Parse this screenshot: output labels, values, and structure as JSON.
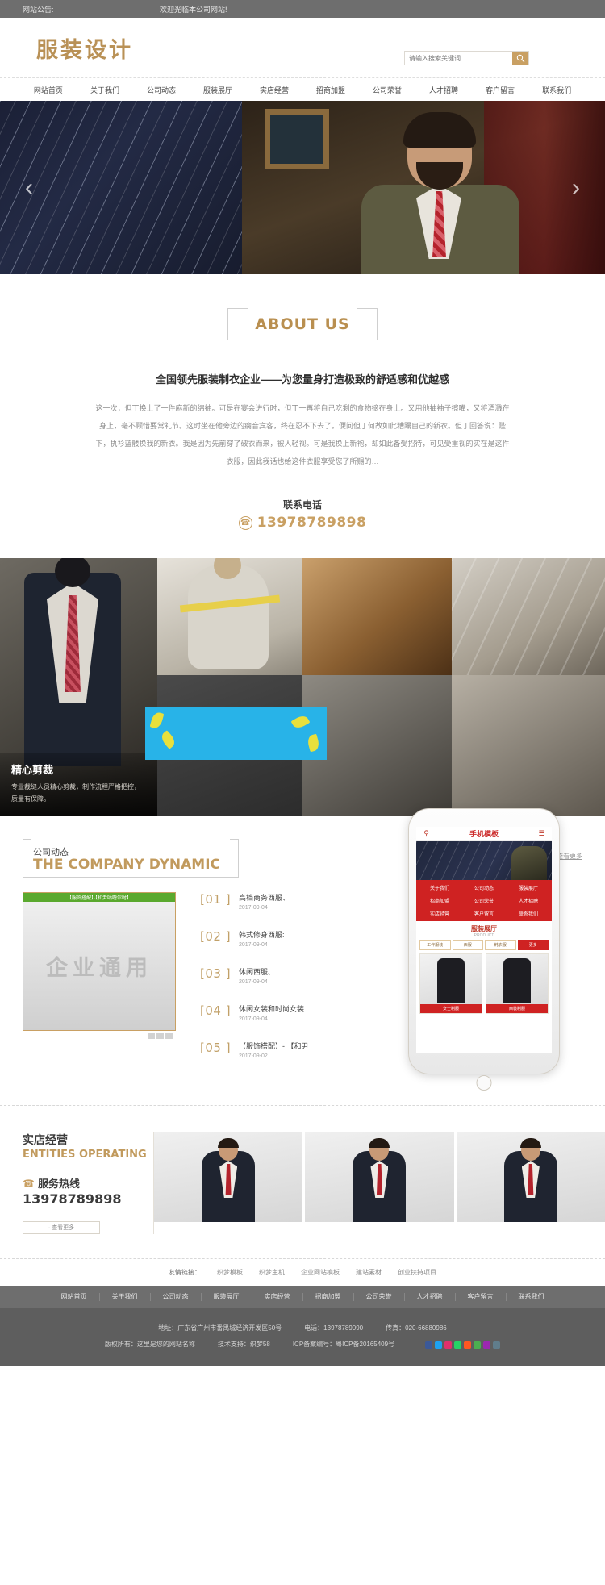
{
  "topbar": {
    "label": "网站公告:",
    "message": "欢迎光临本公司网站!"
  },
  "header": {
    "logo": "服装设计",
    "search": {
      "placeholder": "请输入搜索关键词",
      "value": "",
      "icon": "search-icon"
    }
  },
  "nav": [
    {
      "label": "网站首页"
    },
    {
      "label": "关于我们"
    },
    {
      "label": "公司动态"
    },
    {
      "label": "服装展厅"
    },
    {
      "label": "实店经营"
    },
    {
      "label": "招商加盟"
    },
    {
      "label": "公司荣誉"
    },
    {
      "label": "人才招聘"
    },
    {
      "label": "客户留言"
    },
    {
      "label": "联系我们"
    }
  ],
  "banner": {
    "prev_icon": "chevron-left-icon",
    "next_icon": "chevron-right-icon"
  },
  "about": {
    "badge": "ABOUT US",
    "headline": "全国领先服装制衣企业——为您量身打造极致的舒适感和优越感",
    "body": "这一次，但丁换上了一件麻新的绵袖。可是在宴会进行时，但丁一再将自己吃剩的食物摘在身上。又用他抽袖子擦嘴，又将酒溅在身上，毫不顾惜要常礼节。这时坐在他旁边的瘸音宾客，终在忍不下去了。便问但丁何故如此糟蹋自己的新衣。但丁回答说：陛下，执衫蓝髅换我的新衣。我是因为先前穿了破衣而来，被人轻视。可是我换上新袍，却如此备受招待，可见受重视的实在是这件衣服，因此我话也给这件衣服享受您了所赐的…",
    "contact_title": "联系电话",
    "contact_phone": "13978789898",
    "phone_icon": "phone-icon"
  },
  "gallery": {
    "overlay": {
      "title": "精心剪裁",
      "desc": "专业裁缝人员精心剪裁，制作流程严格把控，质量有保障。"
    }
  },
  "dynamic": {
    "cn_title": "公司动态",
    "en_title": "THE COMPANY DYNAMIC",
    "more": "查看更多",
    "slider": {
      "caption": "【服饰搭配】·【和尹咕噜尔时】",
      "watermark": "企业通用",
      "dots": [
        "",
        "",
        ""
      ]
    },
    "news": [
      {
        "no": "[01 ]",
        "title": "高档商务西服、",
        "date": "2017-09-04"
      },
      {
        "no": "[02 ]",
        "title": "韩式修身西服:",
        "date": "2017-09-04"
      },
      {
        "no": "[03 ]",
        "title": "休闲西服、",
        "date": "2017-09-04"
      },
      {
        "no": "[04 ]",
        "title": "休闲女装和时尚女装",
        "date": "2017-09-04"
      },
      {
        "no": "[05 ]",
        "title": "【服饰搭配】- 【和尹",
        "date": "2017-09-02"
      }
    ]
  },
  "phone_mock": {
    "brand": "手机模板",
    "search_icon": "search-icon",
    "menu_icon": "hamburger-icon",
    "nav": [
      "关于我们",
      "公司动态",
      "服装展厅",
      "招商加盟",
      "公司荣誉",
      "人才招聘",
      "实店经营",
      "客户留言",
      "联系我们"
    ],
    "section_cn": "服装展厅",
    "section_en": "PRODUCT",
    "tabs": [
      {
        "label": "工作服装",
        "active": false
      },
      {
        "label": "西服",
        "active": false
      },
      {
        "label": "韩衣服",
        "active": false
      },
      {
        "label": "更多",
        "active": true
      }
    ],
    "cards": [
      {
        "caption": "女士制服"
      },
      {
        "caption": "西装制服"
      }
    ]
  },
  "entities": {
    "cn_title": "实店经营",
    "en_title": "ENTITIES OPERATING",
    "hotline_label": "服务热线",
    "hotline_icon": "phone-icon",
    "hotline_number": "13978789898",
    "more_button": "· 查看更多"
  },
  "friendlinks": {
    "label": "友情链接：",
    "items": [
      "织梦模板",
      "织梦主机",
      "企业网站模板",
      "建站素材",
      "创业扶持项目"
    ]
  },
  "footer": {
    "nav": [
      "网站首页",
      "关于我们",
      "公司动态",
      "服装展厅",
      "实店经营",
      "招商加盟",
      "公司荣誉",
      "人才招聘",
      "客户留言",
      "联系我们"
    ],
    "address_label": "地址：",
    "address": "广东省广州市番禺城经济开发区50号",
    "tel_label": "电话：",
    "tel": "13978789090",
    "fax_label": "传真：",
    "fax": "020-66880986",
    "copyright_label": "版权所有：",
    "copyright": "这里是您的网站名称",
    "tech_label": "技术支持：",
    "tech": "织梦58",
    "icp_label": "ICP备案编号：",
    "icp": "粤ICP备20165409号",
    "socials": [
      "#3b5998",
      "#1da1f2",
      "#e1306c",
      "#25d366",
      "#ff5722",
      "#4caf50",
      "#9c27b0",
      "#607d8b"
    ]
  }
}
